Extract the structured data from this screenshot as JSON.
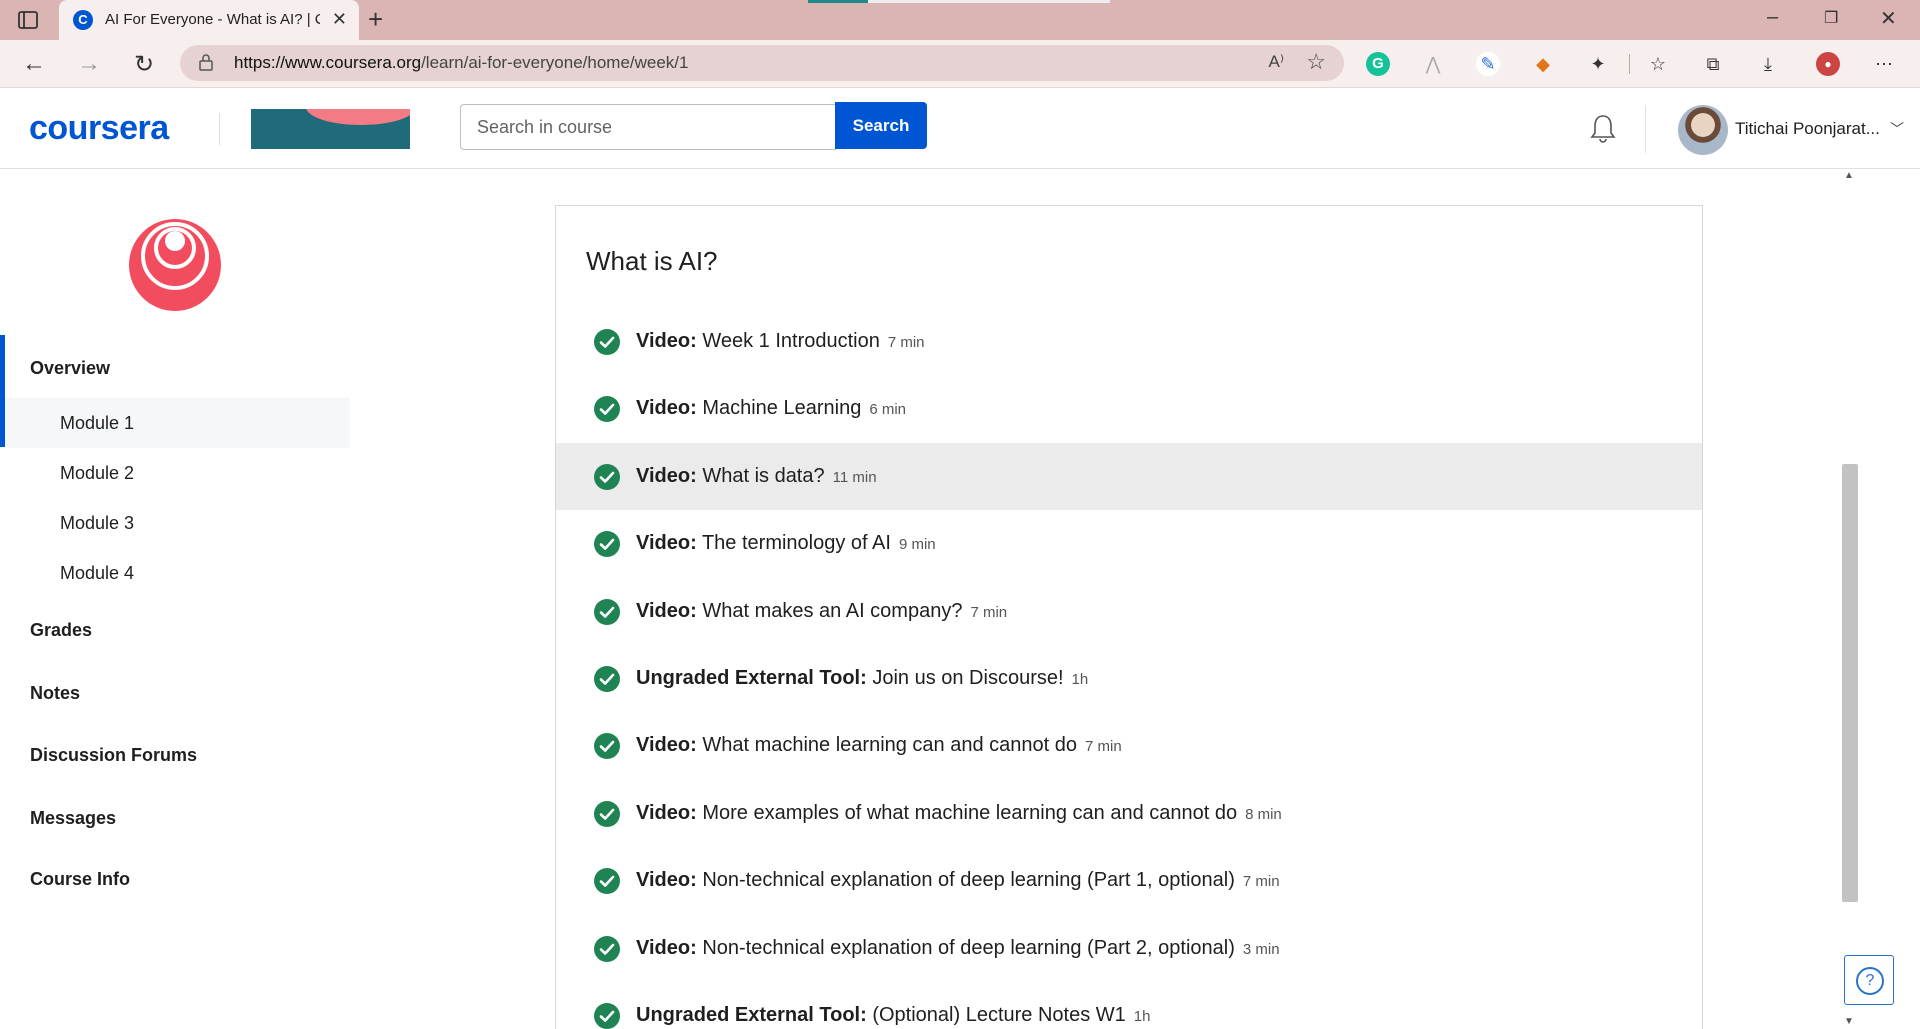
{
  "browser": {
    "tab_title": "AI For Everyone - What is AI? | Co",
    "tab_favicon_letter": "C",
    "url_domain": "https://www.coursera.org",
    "url_path": "/learn/ai-for-everyone/home/week/1",
    "read_aloud_label": "A⁾",
    "grammarly_letter": "G"
  },
  "header": {
    "logo": "coursera",
    "search_placeholder": "Search in course",
    "search_button": "Search",
    "user_name": "Titichai Poonjarat..."
  },
  "sidebar": {
    "overview": "Overview",
    "modules": [
      "Module 1",
      "Module 2",
      "Module 3",
      "Module 4"
    ],
    "selected_module": "Module 1",
    "links": [
      "Grades",
      "Notes",
      "Discussion Forums",
      "Messages",
      "Course Info"
    ]
  },
  "main": {
    "section_title": "What is AI?",
    "items": [
      {
        "type": "Video:",
        "title": "Week 1 Introduction",
        "duration": "7 min"
      },
      {
        "type": "Video:",
        "title": "Machine Learning",
        "duration": "6 min"
      },
      {
        "type": "Video:",
        "title": "What is data?",
        "duration": "11 min"
      },
      {
        "type": "Video:",
        "title": "The terminology of AI",
        "duration": "9 min"
      },
      {
        "type": "Video:",
        "title": "What makes an AI company?",
        "duration": "7 min"
      },
      {
        "type": "Ungraded External Tool:",
        "title": "Join us on Discourse!",
        "duration": "1h"
      },
      {
        "type": "Video:",
        "title": "What machine learning can and cannot do",
        "duration": "7 min"
      },
      {
        "type": "Video:",
        "title": "More examples of what machine learning can and cannot do",
        "duration": "8 min"
      },
      {
        "type": "Video:",
        "title": "Non-technical explanation of deep learning (Part 1, optional)",
        "duration": "7 min"
      },
      {
        "type": "Video:",
        "title": "Non-technical explanation of deep learning (Part 2, optional)",
        "duration": "3 min"
      },
      {
        "type": "Ungraded External Tool:",
        "title": "(Optional) Lecture Notes W1",
        "duration": "1h"
      }
    ]
  },
  "help_label": "?",
  "colors": {
    "brand": "#0056d2",
    "check": "#1f8354",
    "course_logo": "#f24d5e"
  }
}
